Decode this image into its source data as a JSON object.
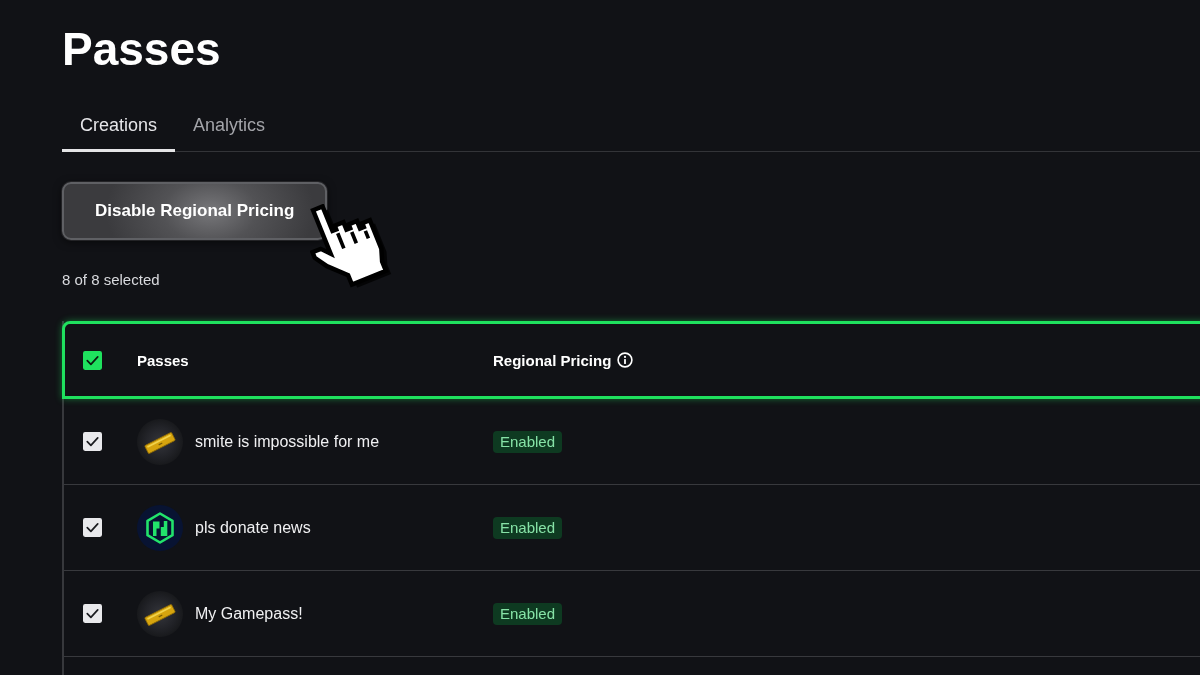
{
  "page": {
    "title": "Passes"
  },
  "tabs": [
    {
      "label": "Creations",
      "selected": true
    },
    {
      "label": "Analytics",
      "selected": false
    }
  ],
  "toolbar": {
    "button": {
      "label": "Disable Regional Pricing",
      "hovered": true
    },
    "selection_count": "8 of 8 selected"
  },
  "table": {
    "highlighted": true,
    "select_all": {
      "checked": true
    },
    "columns": [
      {
        "label": "Passes",
        "info": false
      },
      {
        "label": "Regional Pricing",
        "info": true
      }
    ],
    "rows": [
      {
        "checked": true,
        "kind": "ticket",
        "name": "smite is impossible for me",
        "regional_pricing": "Enabled"
      },
      {
        "checked": true,
        "kind": "logo",
        "name": "pls donate news",
        "regional_pricing": "Enabled"
      },
      {
        "checked": true,
        "kind": "ticket",
        "name": "My Gamepass!",
        "regional_pricing": "Enabled"
      }
    ]
  }
}
